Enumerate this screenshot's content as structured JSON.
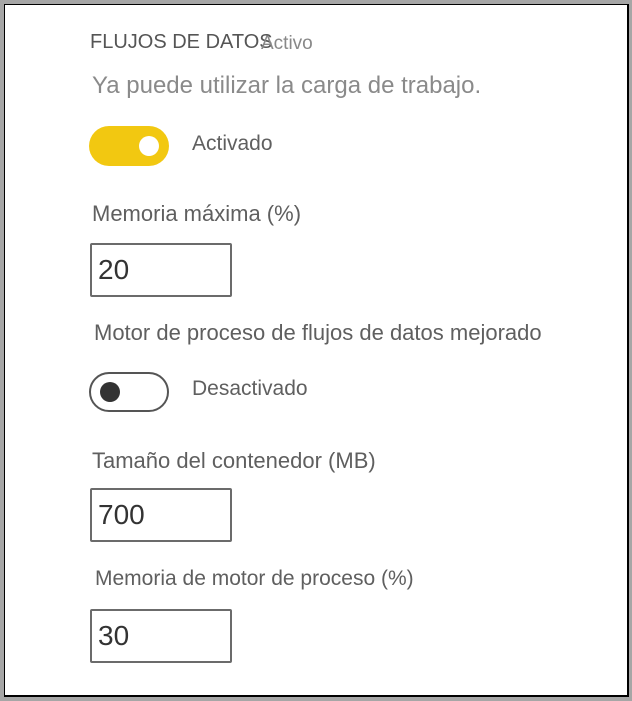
{
  "section_title": "FLUJOS DE DATOS",
  "status_overlay": "Activo",
  "subtitle": "Ya puede utilizar la carga de trabajo.",
  "workload_toggle": {
    "state": "on",
    "label": "Activado",
    "color": "#f2c811"
  },
  "max_memory": {
    "label": "Memoria máxima (%)",
    "value": "20"
  },
  "enhanced_engine": {
    "label": "Motor de proceso de flujos de datos mejorado",
    "toggle_state": "off",
    "toggle_label": "Desactivado"
  },
  "container_size": {
    "label": "Tamaño del contenedor (MB)",
    "value": "700"
  },
  "engine_memory": {
    "label": "Memoria de motor de proceso (%)",
    "value": "30"
  }
}
